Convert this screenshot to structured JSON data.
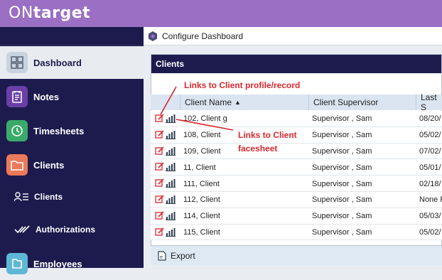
{
  "app": {
    "logo_prefix": "ON",
    "logo_suffix": "target"
  },
  "sidebar": {
    "items": [
      {
        "label": "Dashboard",
        "icon": "dashboard-grid-icon",
        "active": true,
        "color": "#c9d3df"
      },
      {
        "label": "Notes",
        "icon": "notes-icon",
        "color": "#6a3fa8"
      },
      {
        "label": "Timesheets",
        "icon": "clock-icon",
        "color": "#3aaa6a"
      },
      {
        "label": "Clients",
        "icon": "folder-icon",
        "color": "#ec7a5a"
      },
      {
        "label": "Clients",
        "icon": "clients-list-icon",
        "sub": true
      },
      {
        "label": "Authorizations",
        "icon": "double-check-icon",
        "sub": true
      },
      {
        "label": "Employees",
        "icon": "employees-icon",
        "color": "#5fb7d6"
      }
    ]
  },
  "breadcrumb": {
    "title": "Configure Dashboard"
  },
  "panel": {
    "title": "Clients"
  },
  "table": {
    "columns": [
      "Client Name",
      "Client Supervisor",
      "Last S"
    ],
    "rows": [
      {
        "name": "102, Client g",
        "supervisor": "Supervisor , Sam",
        "last": "08/20/"
      },
      {
        "name": "108, Client",
        "supervisor": "Supervisor , Sam",
        "last": "05/02/"
      },
      {
        "name": "109, Client",
        "supervisor": "Supervisor , Sam",
        "last": "07/02/"
      },
      {
        "name": "11, Client",
        "supervisor": "Supervisor , Sam",
        "last": "05/01/"
      },
      {
        "name": "111, Client",
        "supervisor": "Supervisor , Sam",
        "last": "02/18/"
      },
      {
        "name": "112, Client",
        "supervisor": "Supervisor , Sam",
        "last": "None F"
      },
      {
        "name": "114, Client",
        "supervisor": "Supervisor , Sam",
        "last": "05/03/"
      },
      {
        "name": "115, Client",
        "supervisor": "Supervisor , Sam",
        "last": "05/02/"
      }
    ]
  },
  "footer": {
    "export_label": "Export"
  },
  "annotations": {
    "profile_link": "Links to Client profile/record",
    "facesheet_link_line1": "Links to Client",
    "facesheet_link_line2": "facesheet"
  },
  "colors": {
    "accent_purple": "#9b6fc4",
    "sidebar_navy": "#1d1b4e",
    "annotation_red": "#d9272e"
  }
}
